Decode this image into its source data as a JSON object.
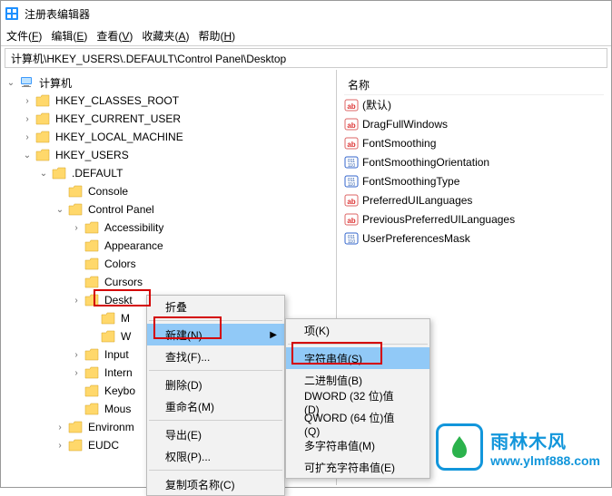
{
  "title": "注册表编辑器",
  "menubar": [
    {
      "label": "文件",
      "key": "F"
    },
    {
      "label": "编辑",
      "key": "E"
    },
    {
      "label": "查看",
      "key": "V"
    },
    {
      "label": "收藏夹",
      "key": "A"
    },
    {
      "label": "帮助",
      "key": "H"
    }
  ],
  "addressbar": "计算机\\HKEY_USERS\\.DEFAULT\\Control Panel\\Desktop",
  "tree": [
    {
      "l": 0,
      "exp": "open",
      "icon": "pc",
      "label": "计算机"
    },
    {
      "l": 1,
      "exp": "closed",
      "icon": "folder",
      "label": "HKEY_CLASSES_ROOT"
    },
    {
      "l": 1,
      "exp": "closed",
      "icon": "folder",
      "label": "HKEY_CURRENT_USER"
    },
    {
      "l": 1,
      "exp": "closed",
      "icon": "folder",
      "label": "HKEY_LOCAL_MACHINE"
    },
    {
      "l": 1,
      "exp": "open",
      "icon": "folder",
      "label": "HKEY_USERS"
    },
    {
      "l": 2,
      "exp": "open",
      "icon": "folder",
      "label": ".DEFAULT"
    },
    {
      "l": 3,
      "exp": "none",
      "icon": "folder",
      "label": "Console"
    },
    {
      "l": 3,
      "exp": "open",
      "icon": "folder",
      "label": "Control Panel"
    },
    {
      "l": 4,
      "exp": "closed",
      "icon": "folder",
      "label": "Accessibility"
    },
    {
      "l": 4,
      "exp": "none",
      "icon": "folder",
      "label": "Appearance"
    },
    {
      "l": 4,
      "exp": "none",
      "icon": "folder",
      "label": "Colors"
    },
    {
      "l": 4,
      "exp": "none",
      "icon": "folder",
      "label": "Cursors"
    },
    {
      "l": 4,
      "exp": "closed",
      "icon": "folder",
      "label": "Deskt"
    },
    {
      "l": 5,
      "exp": "none",
      "icon": "folder",
      "label": "M"
    },
    {
      "l": 5,
      "exp": "none",
      "icon": "folder",
      "label": "W"
    },
    {
      "l": 4,
      "exp": "closed",
      "icon": "folder",
      "label": "Input"
    },
    {
      "l": 4,
      "exp": "closed",
      "icon": "folder",
      "label": "Intern"
    },
    {
      "l": 4,
      "exp": "none",
      "icon": "folder",
      "label": "Keybo"
    },
    {
      "l": 4,
      "exp": "none",
      "icon": "folder",
      "label": "Mous"
    },
    {
      "l": 3,
      "exp": "closed",
      "icon": "folder",
      "label": "Environm"
    },
    {
      "l": 3,
      "exp": "closed",
      "icon": "folder",
      "label": "EUDC"
    }
  ],
  "list_header": "名称",
  "list": [
    {
      "icon": "ab",
      "label": "(默认)"
    },
    {
      "icon": "ab",
      "label": "DragFullWindows"
    },
    {
      "icon": "ab",
      "label": "FontSmoothing"
    },
    {
      "icon": "bin",
      "label": "FontSmoothingOrientation"
    },
    {
      "icon": "bin",
      "label": "FontSmoothingType"
    },
    {
      "icon": "ab",
      "label": "PreferredUILanguages"
    },
    {
      "icon": "ab",
      "label": "PreviousPreferredUILanguages"
    },
    {
      "icon": "bin",
      "label": "UserPreferencesMask"
    }
  ],
  "ctx1": {
    "collapse": "折叠",
    "new": "新建(N)",
    "find": "查找(F)...",
    "delete": "删除(D)",
    "rename": "重命名(M)",
    "export": "导出(E)",
    "perm": "权限(P)...",
    "copy": "复制项名称(C)"
  },
  "ctx2": {
    "key": "项(K)",
    "string": "字符串值(S)",
    "binary": "二进制值(B)",
    "dword": "DWORD (32 位)值(D)",
    "qword": "QWORD (64 位)值(Q)",
    "multi": "多字符串值(M)",
    "exp": "可扩充字符串值(E)"
  },
  "watermark": {
    "cn": "雨林木风",
    "url": "www.ylmf888.com"
  }
}
